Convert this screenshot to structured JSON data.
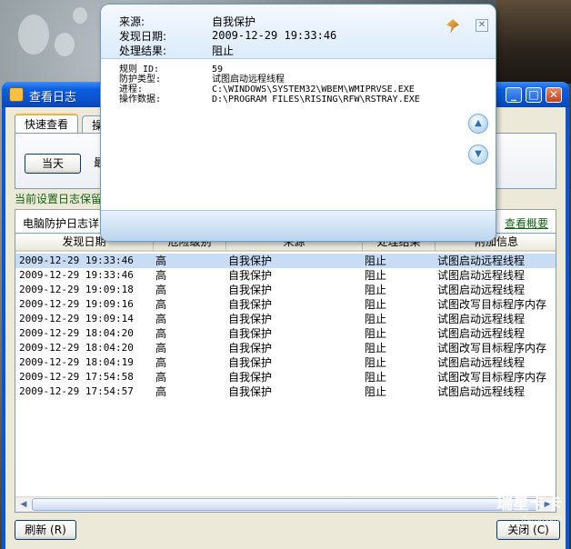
{
  "window": {
    "title": "查看日志",
    "min_glyph": "_",
    "max_glyph": "□",
    "close_glyph": "✕"
  },
  "tabs": [
    {
      "label": "快速查看",
      "active": true
    },
    {
      "label": "操",
      "active": false
    }
  ],
  "quick": {
    "today_label": "当天",
    "recent_label": "最"
  },
  "retention_text": "当前设置日志保留",
  "group": {
    "title": "电脑防护日志详",
    "overview_link": "查看概要"
  },
  "table": {
    "columns": [
      "发现日期",
      "危险级别",
      "来源",
      "处理结果",
      "附加信息"
    ],
    "rows": [
      [
        "2009-12-29 19:33:46",
        "高",
        "自我保护",
        "阻止",
        "试图启动远程线程"
      ],
      [
        "2009-12-29 19:33:46",
        "高",
        "自我保护",
        "阻止",
        "试图启动远程线程"
      ],
      [
        "2009-12-29 19:09:18",
        "高",
        "自我保护",
        "阻止",
        "试图启动远程线程"
      ],
      [
        "2009-12-29 19:09:16",
        "高",
        "自我保护",
        "阻止",
        "试图改写目标程序内存"
      ],
      [
        "2009-12-29 19:09:14",
        "高",
        "自我保护",
        "阻止",
        "试图启动远程线程"
      ],
      [
        "2009-12-29 18:04:20",
        "高",
        "自我保护",
        "阻止",
        "试图启动远程线程"
      ],
      [
        "2009-12-29 18:04:20",
        "高",
        "自我保护",
        "阻止",
        "试图改写目标程序内存"
      ],
      [
        "2009-12-29 18:04:19",
        "高",
        "自我保护",
        "阻止",
        "试图启动远程线程"
      ],
      [
        "2009-12-29 17:54:58",
        "高",
        "自我保护",
        "阻止",
        "试图改写目标程序内存"
      ],
      [
        "2009-12-29 17:54:57",
        "高",
        "自我保护",
        "阻止",
        "试图启动远程线程"
      ]
    ],
    "selected_row": 0
  },
  "buttons": {
    "refresh": "刷新 (R)",
    "close": "关闭 (C)"
  },
  "popup": {
    "source_label": "来源:",
    "source_value": "自我保护",
    "date_label": "发现日期:",
    "date_value": "2009-12-29 19:33:46",
    "result_label": "处理结果:",
    "result_value": "阻止",
    "rule_id_label": "规则 ID:",
    "rule_id_value": "59",
    "type_label": "防护类型:",
    "type_value": "试图启动远程线程",
    "process_label": "进程:",
    "process_value": "C:\\WINDOWS\\SYSTEM32\\WBEM\\WMIPRVSE.EXE",
    "data_label": "操作数据:",
    "data_value": "D:\\PROGRAM FILES\\RISING\\RFW\\RSTRAY.EXE"
  },
  "watermark": {
    "text": "瑞星卡卡",
    "sub": "ifeng.com"
  },
  "icons": {
    "window": "rising-app-icon",
    "pin": "pin-icon",
    "popup_close": "close-icon",
    "scroll_up": "chevron-up-icon",
    "scroll_down": "chevron-down-icon"
  }
}
